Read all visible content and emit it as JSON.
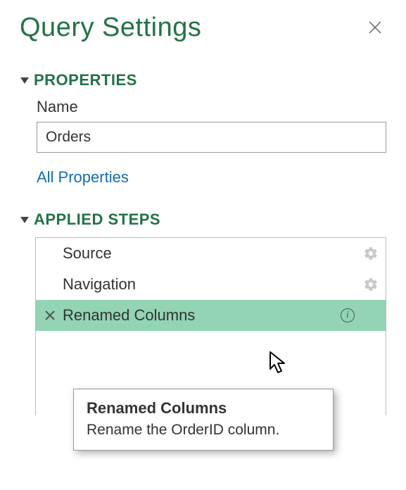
{
  "panel": {
    "title": "Query Settings"
  },
  "properties": {
    "header": "PROPERTIES",
    "name_label": "Name",
    "name_value": "Orders",
    "all_link": "All Properties"
  },
  "steps": {
    "header": "APPLIED STEPS",
    "items": [
      {
        "label": "Source",
        "has_gear": true,
        "selected": false
      },
      {
        "label": "Navigation",
        "has_gear": true,
        "selected": false
      },
      {
        "label": "Renamed Columns",
        "has_gear": false,
        "selected": true,
        "has_info": true
      }
    ]
  },
  "tooltip": {
    "title": "Renamed Columns",
    "description": "Rename the OrderID column."
  },
  "icons": {
    "close": "close-icon",
    "collapse": "triangle-down-icon",
    "gear": "gear-icon",
    "delete": "x-icon",
    "info": "info-icon",
    "cursor": "cursor-icon"
  }
}
